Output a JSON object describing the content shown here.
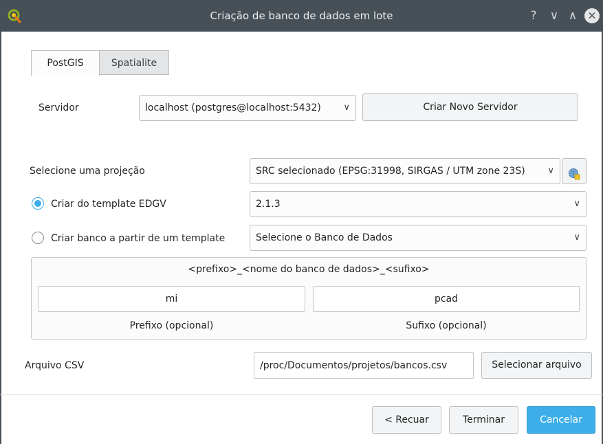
{
  "window": {
    "title": "Criação de banco de dados em lote",
    "app_icon_letter": "Q",
    "help_symbol": "?",
    "minimize_symbol": "∨",
    "maximize_symbol": "∧",
    "close_symbol": "✕"
  },
  "tabs": [
    {
      "label": "PostGIS",
      "active": true
    },
    {
      "label": "Spatialite",
      "active": false
    }
  ],
  "server": {
    "label": "Servidor",
    "selected": "localhost (postgres@localhost:5432)",
    "new_button": "Criar Novo Servidor"
  },
  "projection": {
    "label": "Selecione uma projeção",
    "selected": "SRC selecionado (EPSG:31998, SIRGAS / UTM zone 23S)"
  },
  "template_edgv": {
    "label": "Criar do template EDGV",
    "checked": true,
    "selected": "2.1.3"
  },
  "template_db": {
    "label": "Criar banco a partir de um template",
    "checked": false,
    "selected": "Selecione o Banco de Dados"
  },
  "naming": {
    "pattern": "<prefixo>_<nome do banco de dados>_<sufixo>",
    "prefix_value": "mi",
    "suffix_value": "pcad",
    "prefix_label": "Prefixo (opcional)",
    "suffix_label": "Sufixo (opcional)"
  },
  "csv": {
    "label": "Arquivo CSV",
    "path": "/proc/Documentos/projetos/bancos.csv",
    "select_button": "Selecionar arquivo"
  },
  "footer": {
    "back_button": "< Recuar",
    "finish_button": "Terminar",
    "cancel_button": "Cancelar"
  },
  "colors": {
    "accent": "#3daee9",
    "titlebar": "#475057"
  }
}
